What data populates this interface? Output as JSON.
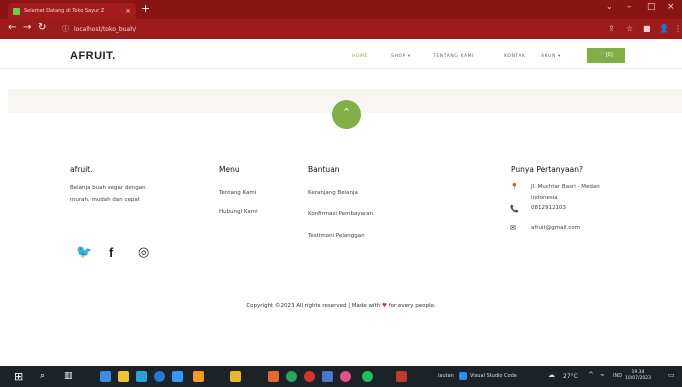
{
  "browser": {
    "tab_title": "Selamat Datang di Toko Sayur Z",
    "tab_close": "×",
    "new_tab": "+",
    "url": "localhost/toko_buah/",
    "min": "–",
    "max": "□",
    "close": "×"
  },
  "site": {
    "logo": "AFRUIT.",
    "nav": [
      {
        "label": "HOME"
      },
      {
        "label": "SHOP ▾"
      },
      {
        "label": "TENTANG KAMI"
      },
      {
        "label": "KONTAK"
      },
      {
        "label": "AKUN ▾"
      }
    ],
    "cart_label": "🛒[0]",
    "scroll_top": "⌃"
  },
  "footer": {
    "brand": {
      "title": "afruit.",
      "desc_line1": "Belanja buah segar dengan",
      "desc_line2": "murah, mudah dan cepat"
    },
    "menu": {
      "title": "Menu",
      "items": [
        "Tentang Kami",
        "Hubungi Kami"
      ]
    },
    "bantuan": {
      "title": "Bantuan",
      "items": [
        "Keranjang Belanja",
        "Konfirmasi Pembayaran",
        "Testimoni Pelanggan"
      ]
    },
    "contact": {
      "title": "Punya Pertanyaan?",
      "address_line1": "Jl. Muchtar Basri - Medan",
      "address_line2": "Indonesia",
      "phone": "0812912103",
      "email": "afruit@gmail.com"
    },
    "copyright_pre": "Copyright ©2023 All rights reserved | Made with",
    "copyright_post": "for every people."
  },
  "taskbar": {
    "search_label": "lautan",
    "vscode_label": "Visual Studio Code",
    "weather": "27°C",
    "lang": "IND",
    "time": "19.34",
    "date": "10/07/2023"
  },
  "colors": {
    "browser_frame": "#8a1414",
    "accent_green": "#82ae46",
    "heart": "#e0282b"
  }
}
